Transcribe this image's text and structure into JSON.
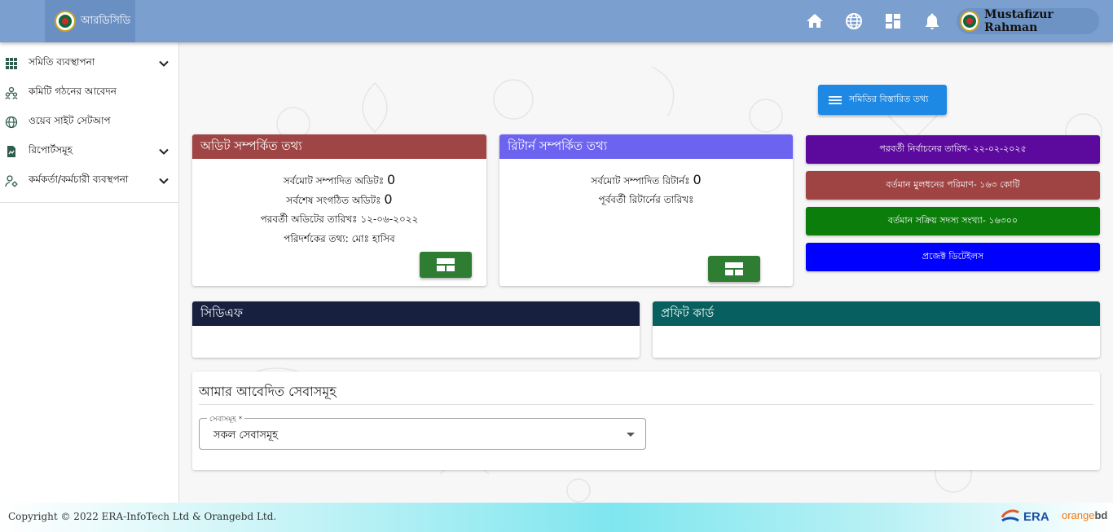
{
  "header": {
    "brand_name": "আরডিসিডি",
    "user_name": "Mustafizur Rahman",
    "icons": [
      "home-icon",
      "globe-icon",
      "dashboard-icon",
      "bell-icon"
    ]
  },
  "sidebar": {
    "items": [
      {
        "label": "সমিতি ব্যবস্থাপনা",
        "icon": "grid-icon",
        "expandable": true
      },
      {
        "label": "কমিটি গঠনের আবেদন",
        "icon": "people-icon",
        "expandable": false
      },
      {
        "label": "ওয়েব সাইট সেটআপ",
        "icon": "globe-icon",
        "expandable": false
      },
      {
        "label": "রিপোর্টসমূহ",
        "icon": "report-icon",
        "expandable": true
      },
      {
        "label": "কর্মকর্তা/কর্মচারী ব্যবস্থপনা",
        "icon": "user-settings-icon",
        "expandable": true
      }
    ]
  },
  "main": {
    "details_button": "সমিতির বিস্তারিত তথ্য",
    "audit_card": {
      "title": "অডিট সম্পর্কিত তথ্য",
      "total_label": "সর্বমোট সম্পাদিত অডিটঃ",
      "total_value": "0",
      "last_label": "সর্বশেষ সংগঠিত অডিটঃ",
      "last_value": "0",
      "next_date": "পরবর্তী অডিটের তারিখঃ ১২-০৬-২০২২",
      "inspector": "পরিদর্শকের তথ্য: মোঃ হাসিব"
    },
    "return_card": {
      "title": "রিটার্ন সম্পর্কিত তথ্য",
      "total_label": "সর্বমোট সম্পাদিত রিটার্নঃ",
      "total_value": "0",
      "prev_date": "পূর্ববর্তী রিটার্নের তারিখঃ"
    },
    "stats": [
      {
        "label": "পরবর্তী নির্বাচনের তারিখ- ২২-০২-২০২৫",
        "color": "#5c0a9e"
      },
      {
        "label": "বর্তমান মুলধনের পরিমাণ- ১৬৩ কোটি",
        "color": "#a04343"
      },
      {
        "label": "বর্তমান সক্রিয় সদস্য সংখ্যা- ১৬৩০০",
        "color": "#0a7d0a"
      },
      {
        "label": "প্রজেক্ট ডিটেইলস",
        "color": "#0000ff"
      }
    ],
    "cdf_card": {
      "title": "সিডিএফ",
      "color": "#17203f"
    },
    "profit_card": {
      "title": "প্রফিট কার্ড",
      "color": "#075f5f"
    },
    "services": {
      "title": "আমার আবেদিত সেবাসমূহ",
      "select_label": "সেবাসমূহ *",
      "select_value": "সকল সেবাসমূহ"
    },
    "colors": {
      "audit_header": "#a04545",
      "return_header": "#6c63f0",
      "grid_button": "#2e7d32",
      "details_button": "#1e88e5"
    }
  },
  "footer": {
    "copyright": "Copyright © 2022 ERA-InfoTech Ltd & Orangebd Ltd.",
    "era_logo": "ERA",
    "orange_logo_a": "orange",
    "orange_logo_b": "bd"
  }
}
